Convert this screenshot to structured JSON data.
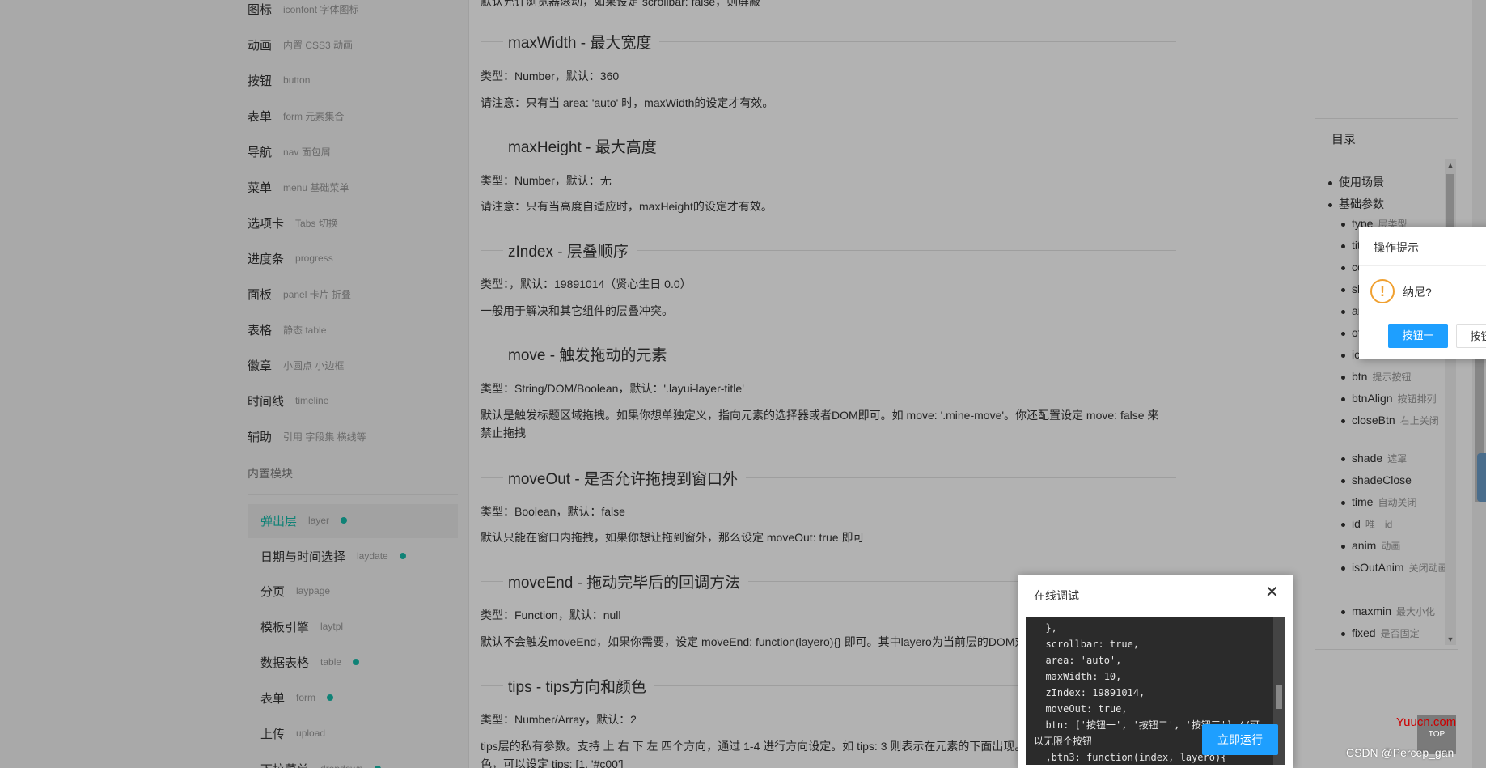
{
  "sidebar": {
    "items": [
      {
        "zh": "图标",
        "en": "iconfont 字体图标",
        "dot": false
      },
      {
        "zh": "动画",
        "en": "内置 CSS3 动画",
        "dot": false
      },
      {
        "zh": "按钮",
        "en": "button",
        "dot": false
      },
      {
        "zh": "表单",
        "en": "form 元素集合",
        "dot": false
      },
      {
        "zh": "导航",
        "en": "nav 面包屑",
        "dot": false
      },
      {
        "zh": "菜单",
        "en": "menu 基础菜单",
        "dot": false
      },
      {
        "zh": "选项卡",
        "en": "Tabs 切换",
        "dot": false
      },
      {
        "zh": "进度条",
        "en": "progress",
        "dot": false
      },
      {
        "zh": "面板",
        "en": "panel 卡片 折叠",
        "dot": false
      },
      {
        "zh": "表格",
        "en": "静态 table",
        "dot": false
      },
      {
        "zh": "徽章",
        "en": "小圆点 小边框",
        "dot": false
      },
      {
        "zh": "时间线",
        "en": "timeline",
        "dot": false
      },
      {
        "zh": "辅助",
        "en": "引用 字段集 横线等",
        "dot": false
      }
    ],
    "section_label": "内置模块",
    "modules": [
      {
        "zh": "弹出层",
        "en": "layer",
        "dot": true,
        "active": true
      },
      {
        "zh": "日期与时间选择",
        "en": "laydate",
        "dot": true
      },
      {
        "zh": "分页",
        "en": "laypage",
        "dot": false
      },
      {
        "zh": "模板引擎",
        "en": "laytpl",
        "dot": false
      },
      {
        "zh": "数据表格",
        "en": "table",
        "dot": true
      },
      {
        "zh": "表单",
        "en": "form",
        "dot": true
      },
      {
        "zh": "上传",
        "en": "upload",
        "dot": false
      },
      {
        "zh": "下拉菜单",
        "en": "dropdown",
        "dot": true
      }
    ]
  },
  "main": {
    "cut_line": "默认允许浏览器滚动，如果设定 scrollbar: false，则屏蔽",
    "sections": [
      {
        "title": "maxWidth - 最大宽度",
        "lines": [
          "类型：Number，默认：360",
          "请注意：只有当 area: 'auto' 时，maxWidth的设定才有效。"
        ]
      },
      {
        "title": "maxHeight - 最大高度",
        "lines": [
          "类型：Number，默认：无",
          "请注意：只有当高度自适应时，maxHeight的设定才有效。"
        ]
      },
      {
        "title": "zIndex - 层叠顺序",
        "lines": [
          "类型：，默认：19891014（贤心生日 0.0）",
          "一般用于解决和其它组件的层叠冲突。"
        ]
      },
      {
        "title": "move - 触发拖动的元素",
        "lines": [
          "类型：String/DOM/Boolean，默认：'.layui-layer-title'",
          "默认是触发标题区域拖拽。如果你想单独定义，指向元素的选择器或者DOM即可。如 move: '.mine-move'。你还配置设定 move: false 来禁止拖拽"
        ]
      },
      {
        "title": "moveOut - 是否允许拖拽到窗口外",
        "lines": [
          "类型：Boolean，默认：false",
          "默认只能在窗口内拖拽，如果你想让拖到窗外，那么设定 moveOut: true 即可"
        ]
      },
      {
        "title": "moveEnd - 拖动完毕后的回调方法",
        "lines": [
          "类型：Function，默认：null",
          "默认不会触发moveEnd，如果你需要，设定 moveEnd: function(layero){} 即可。其中layero为当前层的DOM对象"
        ]
      },
      {
        "title": "tips - tips方向和颜色",
        "lines": [
          "类型：Number/Array，默认：2",
          "tips层的私有参数。支持 上 右 下 左 四个方向，通过 1-4 进行方向设定。如 tips: 3 则表示在元素的下面出现。有时你还可能会定义一些颜色，可以设定 tips: [1, '#c00']"
        ]
      }
    ]
  },
  "toc": {
    "title": "目录",
    "items": [
      {
        "label": "使用场景",
        "note": "",
        "level": 1
      },
      {
        "label": "基础参数",
        "note": "",
        "level": 1
      },
      {
        "label": "type",
        "note": "层类型",
        "level": 2
      },
      {
        "label": "title",
        "note": "",
        "level": 2
      },
      {
        "label": "content",
        "note": "",
        "level": 2
      },
      {
        "label": "skin",
        "note": "",
        "level": 2
      },
      {
        "label": "area",
        "note": "",
        "level": 2
      },
      {
        "label": "offset",
        "note": "",
        "level": 2
      },
      {
        "label": "icon",
        "note": "",
        "level": 2
      },
      {
        "label": "btn",
        "note": "提示按钮",
        "level": 2
      },
      {
        "label": "btnAlign",
        "note": "按钮排列",
        "level": 2
      },
      {
        "label": "closeBtn",
        "note": "右上关闭",
        "level": 2
      },
      {
        "label": "shade",
        "note": "遮罩",
        "level": 2
      },
      {
        "label": "shadeClose",
        "note": "",
        "level": 2
      },
      {
        "label": "time",
        "note": "自动关闭",
        "level": 2
      },
      {
        "label": "id",
        "note": "唯一id",
        "level": 2
      },
      {
        "label": "anim",
        "note": "动画",
        "level": 2
      },
      {
        "label": "isOutAnim",
        "note": "关闭动画",
        "level": 2
      },
      {
        "label": "maxmin",
        "note": "最大小化",
        "level": 2
      },
      {
        "label": "fixed",
        "note": "是否固定",
        "level": 2
      }
    ]
  },
  "layer_dialog": {
    "title": "操作提示",
    "icon": "warning-icon",
    "icon_glyph": "!",
    "message": "纳尼?",
    "btn1": "按钮一",
    "btn2": "按钮二"
  },
  "debug_panel": {
    "title": "在线调试",
    "close_glyph": "✕",
    "code": "  },\n  scrollbar: true,\n  area: 'auto',\n  maxWidth: 10,\n  zIndex: 19891014,\n  moveOut: true,\n  btn: ['按钮一', '按钮二', '按钮三'] //可\n以无限个按钮\n  ,btn3: function(index, layero){",
    "run_label": "立即运行"
  },
  "back_top_label": "TOP",
  "watermark": {
    "site": "Yuucn.com",
    "author": "CSDN @Percep_gan"
  },
  "colors": {
    "accent": "#16baaa",
    "primary": "#1e9fff",
    "warning": "#f0a030"
  }
}
